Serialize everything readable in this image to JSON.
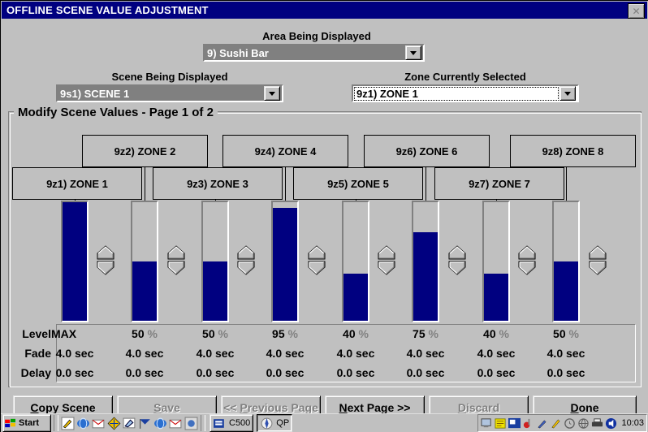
{
  "window": {
    "title": "OFFLINE SCENE VALUE ADJUSTMENT",
    "close_icon": "close-icon",
    "close_label": "✕",
    "titlebar_color": "#000080",
    "face_color": "#c0c0c0",
    "fill_color": "#000080"
  },
  "fields": {
    "area": {
      "label": "Area Being Displayed",
      "value": "9) Sushi Bar"
    },
    "scene": {
      "label": "Scene Being Displayed",
      "value": "9s1) SCENE 1"
    },
    "zone": {
      "label": "Zone Currently Selected",
      "value": "9z1) ZONE 1"
    }
  },
  "group": {
    "title": "Modify Scene Values - Page 1 of 2"
  },
  "zones": [
    {
      "label": "9z1) ZONE 1",
      "level": "MAX",
      "level_pct": 100,
      "fade": "4.0 sec",
      "delay": "0.0 sec"
    },
    {
      "label": "9z2) ZONE 2",
      "level": "50",
      "level_pct": 50,
      "fade": "4.0 sec",
      "delay": "0.0 sec"
    },
    {
      "label": "9z3) ZONE 3",
      "level": "50",
      "level_pct": 50,
      "fade": "4.0 sec",
      "delay": "0.0 sec"
    },
    {
      "label": "9z4) ZONE 4",
      "level": "95",
      "level_pct": 95,
      "fade": "4.0 sec",
      "delay": "0.0 sec"
    },
    {
      "label": "9z5) ZONE 5",
      "level": "40",
      "level_pct": 40,
      "fade": "4.0 sec",
      "delay": "0.0 sec"
    },
    {
      "label": "9z6) ZONE 6",
      "level": "75",
      "level_pct": 75,
      "fade": "4.0 sec",
      "delay": "0.0 sec"
    },
    {
      "label": "9z7) ZONE 7",
      "level": "40",
      "level_pct": 40,
      "fade": "4.0 sec",
      "delay": "0.0 sec"
    },
    {
      "label": "9z8) ZONE 8",
      "level": "50",
      "level_pct": 50,
      "fade": "4.0 sec",
      "delay": "0.0 sec"
    }
  ],
  "rows": {
    "level": "Level",
    "fade": "Fade",
    "delay": "Delay",
    "percent_symbol": "%"
  },
  "buttons": [
    {
      "label": "Copy Scene",
      "accel": "C",
      "disabled": false
    },
    {
      "label": "Save",
      "accel": "S",
      "disabled": true
    },
    {
      "label": "<< Previous Page",
      "accel": "P",
      "disabled": true
    },
    {
      "label": "Next Page >>",
      "accel": "N",
      "disabled": false
    },
    {
      "label": "Discard",
      "accel": "D",
      "disabled": true
    },
    {
      "label": "Done",
      "accel": "D",
      "disabled": false
    }
  ],
  "taskbar": {
    "start_label": "Start",
    "items": [
      {
        "label": "C500"
      },
      {
        "label": "QP"
      }
    ],
    "time": "10:03"
  },
  "chart_data": {
    "type": "bar",
    "title": "Modify Scene Values - Page 1 of 2",
    "categories": [
      "9z1) ZONE 1",
      "9z2) ZONE 2",
      "9z3) ZONE 3",
      "9z4) ZONE 4",
      "9z5) ZONE 5",
      "9z6) ZONE 6",
      "9z7) ZONE 7",
      "9z8) ZONE 8"
    ],
    "values": [
      100,
      50,
      50,
      95,
      40,
      75,
      40,
      50
    ],
    "value_labels": [
      "MAX",
      "50 %",
      "50 %",
      "95 %",
      "40 %",
      "75 %",
      "40 %",
      "50 %"
    ],
    "xlabel": "",
    "ylabel": "Level",
    "ylim": [
      0,
      100
    ],
    "grid": false,
    "legend": null
  }
}
